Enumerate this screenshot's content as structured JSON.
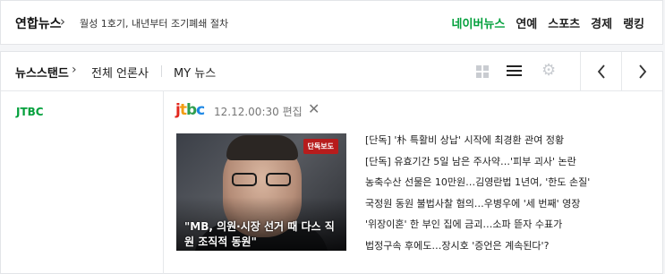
{
  "top_bar": {
    "source": "연합뉴스",
    "headline": "월성 1호기, 내년부터 조기폐쇄 절차",
    "nav": [
      {
        "label": "네이버뉴스",
        "active": true
      },
      {
        "label": "연예",
        "active": false
      },
      {
        "label": "스포츠",
        "active": false
      },
      {
        "label": "경제",
        "active": false
      },
      {
        "label": "랭킹",
        "active": false
      }
    ]
  },
  "panel_header": {
    "standard": "뉴스스탠드",
    "all_press": "전체 언론사",
    "my_news": "MY 뉴스",
    "icons": [
      "grid-view-icon",
      "list-view-icon",
      "gear-icon",
      "chevron-left-icon",
      "chevron-right-icon"
    ]
  },
  "press": {
    "name": "JTBC",
    "logo_text": "jtbc",
    "edited_time": "12.12.00:30 편집",
    "brand_colors": {
      "j": "#e2261c",
      "t": "#f39c12",
      "b": "#2e9e4f",
      "c": "#1e88e5",
      "press_name": "#03a03c"
    }
  },
  "thumbnail": {
    "badge": "단독보도",
    "caption": "\"MB, 의원·시장 선거 때 다스 직원 조직적 동원\""
  },
  "headlines": [
    "[단독] '朴 특활비 상납' 시작에 최경환 관여 정황",
    "[단독] 유효기간 5일 남은 주사약…'피부 괴사' 논란",
    "농축수산 선물은 10만원…김영란법 1년여, '한도 손질'",
    "국정원 동원 불법사찰 혐의…우병우에 '세 번째' 영장",
    "'위장이혼' 한 부인 집에 금괴…소파 뜯자 수표가",
    "법정구속 후에도…장시호 '증언은 계속된다'?"
  ]
}
